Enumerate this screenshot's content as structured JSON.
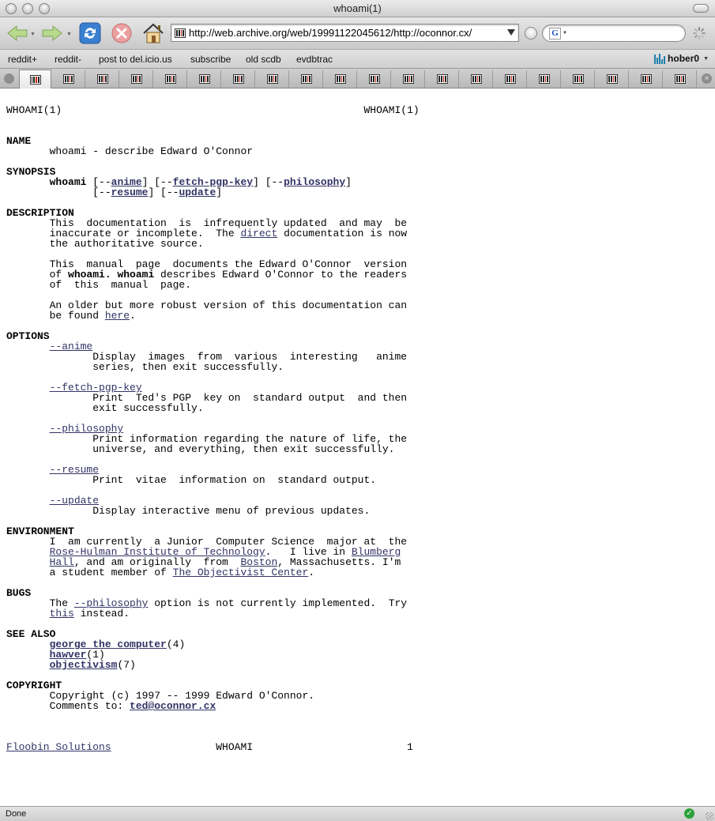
{
  "window": {
    "title": "whoami(1)"
  },
  "toolbar": {
    "url": "http://web.archive.org/web/19991122045612/http://oconnor.cx/",
    "search_value": ""
  },
  "bookmarks": [
    "reddit+",
    "reddit-",
    "post to del.icio.us",
    "subscribe",
    "old scdb",
    "evdbtrac"
  ],
  "user_menu": "hober0",
  "tabs_count_note": "",
  "page": {
    "header_left": "WHOAMI(1)",
    "header_right": "WHOAMI(1)",
    "sec_name": "NAME",
    "name_line": "whoami - describe Edward O'Connor",
    "sec_synopsis": "SYNOPSIS",
    "syn_cmd": "whoami",
    "syn_opt_anime": "anime",
    "syn_opt_fetch": "fetch-pgp-key",
    "syn_opt_philosophy": "philosophy",
    "syn_opt_resume": "resume",
    "syn_opt_update": "update",
    "sec_description": "DESCRIPTION",
    "desc_p1_a": "This  documentation  is  infrequently updated  and may  be",
    "desc_p1_b": "inaccurate or incomplete.  The ",
    "desc_p1_link": "direct",
    "desc_p1_c": " documentation is now",
    "desc_p1_d": "the authoritative source.",
    "desc_p2_a": "This  manual  page  documents the Edward O'Connor  version",
    "desc_p2_b1": "of ",
    "desc_p2_b2": "whoami.",
    "desc_p2_b3": " ",
    "desc_p2_b4": "whoami",
    "desc_p2_b5": " describes Edward O'Connor to the readers",
    "desc_p2_c": "of  this  manual  page.",
    "desc_p3_a": "An older but more robust version of this documentation can",
    "desc_p3_b": "be found ",
    "desc_p3_link": "here",
    "desc_p3_c": ".",
    "sec_options": "OPTIONS",
    "opt_anime": "--anime",
    "opt_anime_d1": "Display  images  from  various  interesting   anime",
    "opt_anime_d2": "series, then exit successfully.",
    "opt_fetch": "--fetch-pgp-key",
    "opt_fetch_d1": "Print  Ted's PGP  key on  standard output  and then",
    "opt_fetch_d2": "exit successfully.",
    "opt_philosophy": "--philosophy",
    "opt_philosophy_d1": "Print information regarding the nature of life, the",
    "opt_philosophy_d2": "universe, and everything, then exit successfully.",
    "opt_resume": "--resume",
    "opt_resume_d1": "Print  vitae  information on  standard output.",
    "opt_update": "--update",
    "opt_update_d1": "Display interactive menu of previous updates.",
    "sec_environment": "ENVIRONMENT",
    "env_l1": "I  am currently  a Junior  Computer Science  major at  the",
    "env_rose": "Rose-Hulman Institute of Technology",
    "env_l2b": ".   I live in ",
    "env_blumberg": "Blumberg",
    "env_hall": "Hall",
    "env_l3a": ", and am originally  from  ",
    "env_boston": "Boston",
    "env_l3b": ", Massachusetts. I'm",
    "env_l4a": "a student member of ",
    "env_objectivist": "The Objectivist Center",
    "env_l4b": ".",
    "sec_bugs": "BUGS",
    "bugs_a": "The ",
    "bugs_link": "--philosophy",
    "bugs_b": " option is not currently implemented.  Try",
    "bugs_this": "this",
    "bugs_c": " instead.",
    "sec_seealso": "SEE ALSO",
    "see_george": "george the computer",
    "see_george_n": "(4)",
    "see_hawver": "hawver",
    "see_hawver_n": "(1)",
    "see_objectivism": "objectivism",
    "see_objectivism_n": "(7)",
    "sec_copyright": "COPYRIGHT",
    "copy_l1": "Copyright (c) 1997 -- 1999 Edward O'Connor.",
    "copy_l2": "Comments to: ",
    "copy_email": "ted@oconnor.cx",
    "footer_left": "Floobin Solutions",
    "footer_mid": "WHOAMI",
    "footer_right": "1"
  },
  "status": {
    "text": "Done"
  },
  "colors": {
    "link": "#333366"
  }
}
